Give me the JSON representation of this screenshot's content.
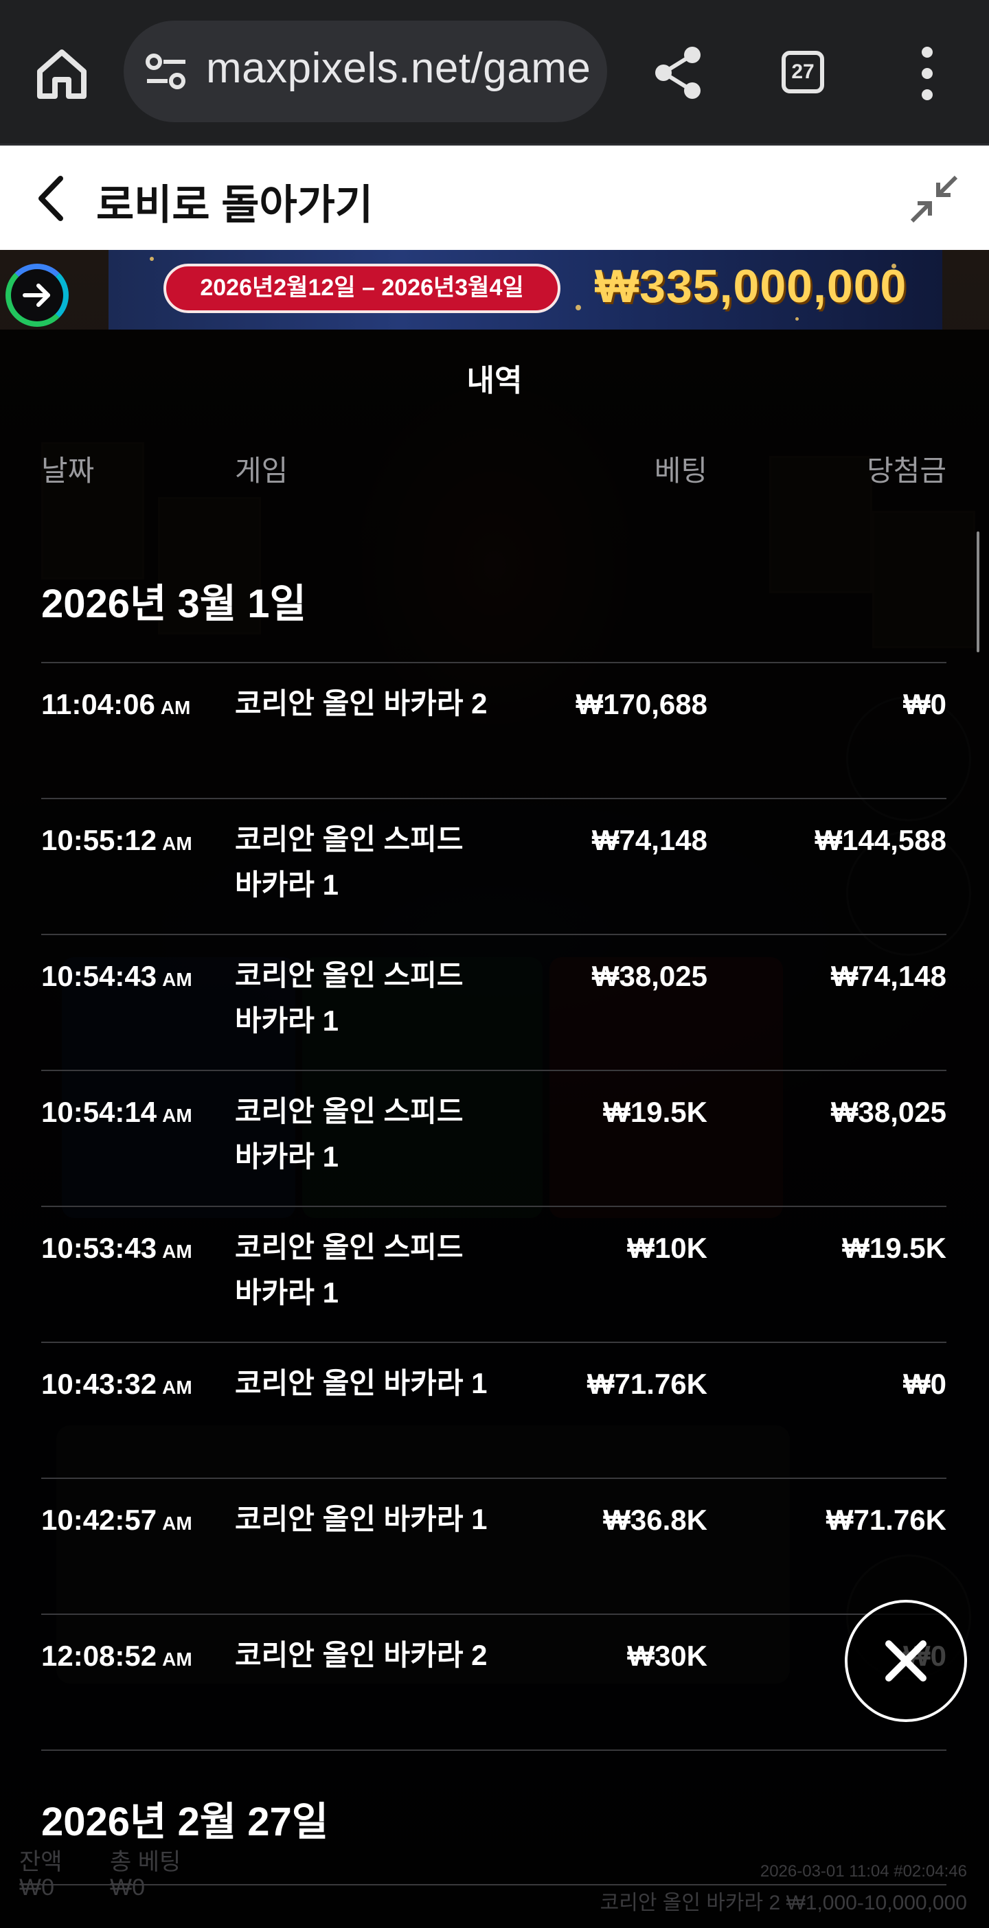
{
  "browser": {
    "url": "maxpixels.net/game",
    "tab_count": "27",
    "icons": [
      "home-icon",
      "site-settings-icon",
      "share-icon",
      "tabs-icon",
      "more-vert-icon"
    ]
  },
  "lobby_bar": {
    "back_label": "로비로 돌아가기",
    "icons": [
      "chevron-left-icon",
      "minimize-icon"
    ]
  },
  "banner": {
    "date_range": "2026년2월12일 – 2026년3월4일",
    "amount": "₩335,000,000"
  },
  "history": {
    "title": "내역",
    "columns": {
      "date": "날짜",
      "game": "게임",
      "bet": "베팅",
      "win": "당첨금"
    },
    "groups": [
      {
        "date": "2026년 3월 1일",
        "rows": [
          {
            "time": "11:04:06",
            "ampm": "AM",
            "game": "코리안 올인 바카라 2",
            "bet": "₩170,688",
            "win": "₩0"
          },
          {
            "time": "10:55:12",
            "ampm": "AM",
            "game": "코리안 올인 스피드 바카라 1",
            "bet": "₩74,148",
            "win": "₩144,588"
          },
          {
            "time": "10:54:43",
            "ampm": "AM",
            "game": "코리안 올인 스피드 바카라 1",
            "bet": "₩38,025",
            "win": "₩74,148"
          },
          {
            "time": "10:54:14",
            "ampm": "AM",
            "game": "코리안 올인 스피드 바카라 1",
            "bet": "₩19.5K",
            "win": "₩38,025"
          },
          {
            "time": "10:53:43",
            "ampm": "AM",
            "game": "코리안 올인 스피드 바카라 1",
            "bet": "₩10K",
            "win": "₩19.5K"
          },
          {
            "time": "10:43:32",
            "ampm": "AM",
            "game": "코리안 올인 바카라 1",
            "bet": "₩71.76K",
            "win": "₩0"
          },
          {
            "time": "10:42:57",
            "ampm": "AM",
            "game": "코리안 올인 바카라 1",
            "bet": "₩36.8K",
            "win": "₩71.76K"
          },
          {
            "time": "12:08:52",
            "ampm": "AM",
            "game": "코리안 올인 바카라 2",
            "bet": "₩30K",
            "win": "₩0"
          }
        ]
      },
      {
        "date": "2026년 2월 27일",
        "rows": []
      }
    ]
  },
  "footer": {
    "balance_label": "잔액",
    "balance_value": "₩0",
    "total_bet_label": "총 베팅",
    "total_bet_value": "₩0",
    "round_info": "2026-03-01 11:04 #02:04:46",
    "table_info": "코리안 올인 바카라 2 ₩1,000-10,000,000"
  },
  "close_icon": "close-icon"
}
